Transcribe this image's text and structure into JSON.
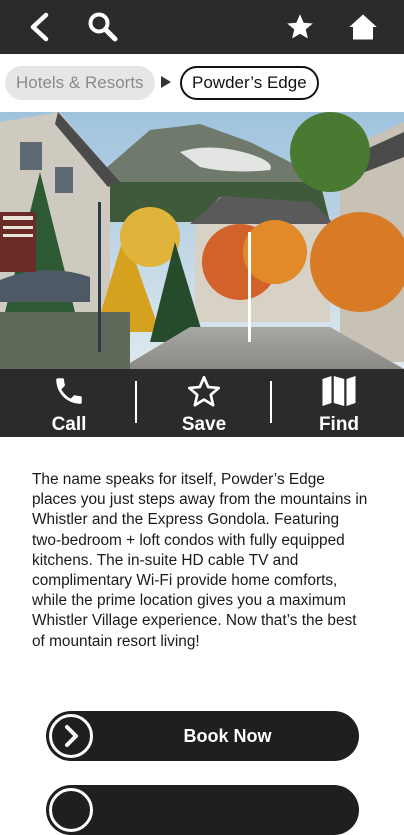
{
  "topbar": {
    "back_icon": "chevron-left-icon",
    "search_icon": "search-icon",
    "favorites_icon": "star-icon",
    "home_icon": "home-icon"
  },
  "breadcrumb": {
    "parent": "Hotels & Resorts",
    "current": "Powder’s Edge"
  },
  "actions": [
    {
      "label": "Call",
      "icon": "phone-icon"
    },
    {
      "label": "Save",
      "icon": "star-outline-icon"
    },
    {
      "label": "Find",
      "icon": "map-icon"
    }
  ],
  "description": "The name speaks for itself, Powder’s Edge places you just steps away from the mountains in Whistler and the Express Gondola. Featuring two-bedroom + loft condos with fully equipped kitchens. The in-suite HD cable TV and complimentary Wi-Fi provide home comforts, while the prime location gives you a maximum Whistler Village experience. Now that’s the best of mountain resort living!",
  "book_button": {
    "label": "Book Now",
    "icon": "chevron-right-icon"
  },
  "colors": {
    "bar": "#2b2b2b",
    "button": "#1f1f1f",
    "text": "#1a1a1a"
  }
}
